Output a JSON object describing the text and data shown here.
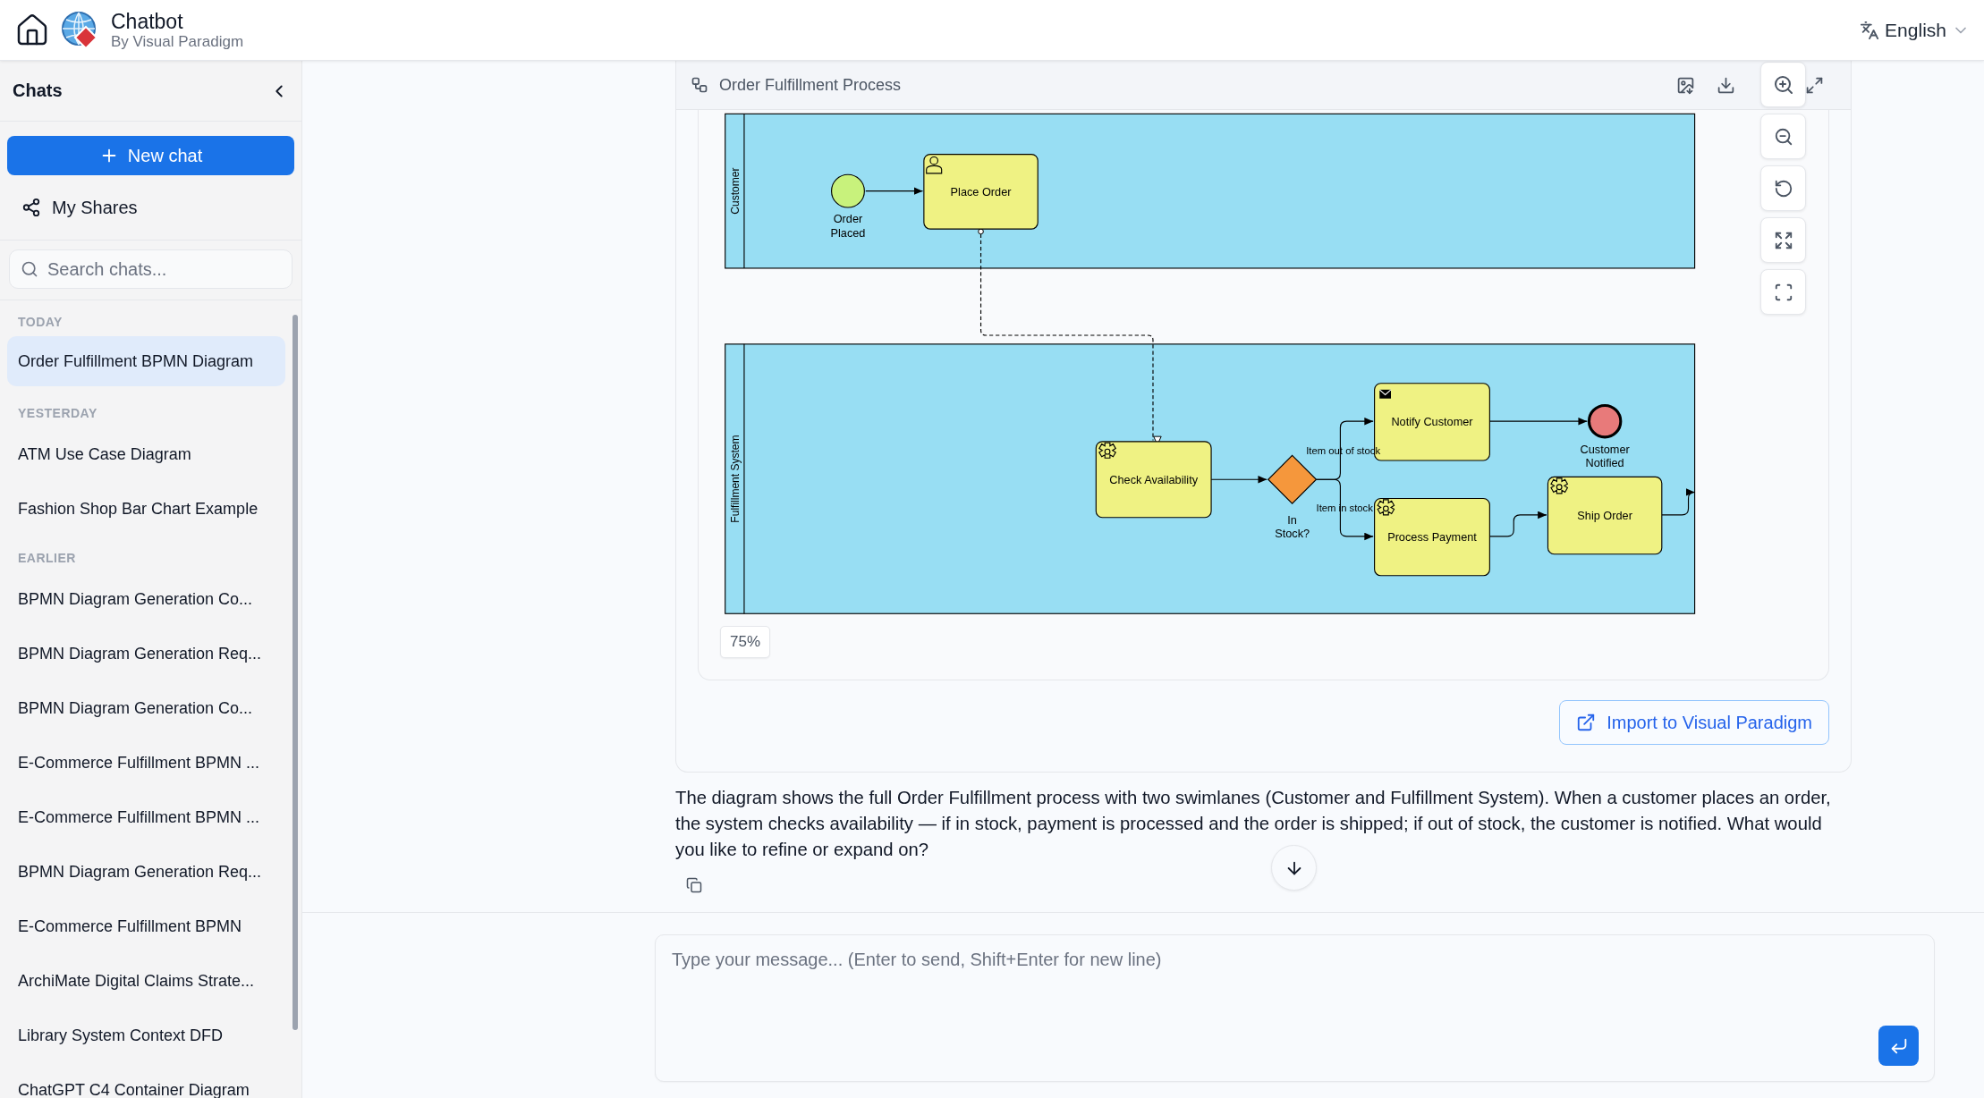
{
  "header": {
    "title": "Chatbot",
    "subtitle": "By Visual Paradigm",
    "language": "English"
  },
  "sidebar": {
    "title": "Chats",
    "new_chat": "New chat",
    "my_shares": "My Shares",
    "search_placeholder": "Search chats...",
    "groups": [
      {
        "label": "TODAY",
        "items": [
          {
            "title": "Order Fulfillment BPMN Diagram",
            "selected": true
          }
        ]
      },
      {
        "label": "YESTERDAY",
        "items": [
          {
            "title": "ATM Use Case Diagram",
            "selected": false
          },
          {
            "title": "Fashion Shop Bar Chart Example",
            "selected": false
          }
        ]
      },
      {
        "label": "EARLIER",
        "items": [
          {
            "title": "BPMN Diagram Generation Co...",
            "selected": false
          },
          {
            "title": "BPMN Diagram Generation Req...",
            "selected": false
          },
          {
            "title": "BPMN Diagram Generation Co...",
            "selected": false
          },
          {
            "title": "E-Commerce Fulfillment BPMN ...",
            "selected": false
          },
          {
            "title": "E-Commerce Fulfillment BPMN ...",
            "selected": false
          },
          {
            "title": "BPMN Diagram Generation Req...",
            "selected": false
          },
          {
            "title": "E-Commerce Fulfillment BPMN",
            "selected": false
          },
          {
            "title": "ArchiMate Digital Claims Strate...",
            "selected": false
          },
          {
            "title": "Library System Context DFD",
            "selected": false
          },
          {
            "title": "ChatGPT C4 Container Diagram",
            "selected": false
          }
        ]
      }
    ]
  },
  "diagram_card": {
    "title": "Order Fulfillment Process",
    "zoom": "75%",
    "import_button": "Import to Visual Paradigm",
    "diagram": {
      "lanes": [
        {
          "name": "Customer"
        },
        {
          "name": "Fulfillment System"
        }
      ],
      "nodes": [
        {
          "kind": "start_event",
          "label": "Order Placed"
        },
        {
          "kind": "user_task",
          "label": "Place Order"
        },
        {
          "kind": "service_task",
          "label": "Check Availability"
        },
        {
          "kind": "gateway",
          "label": "In Stock?"
        },
        {
          "kind": "send_task",
          "label": "Notify Customer"
        },
        {
          "kind": "end_event",
          "label": "Customer Notified"
        },
        {
          "kind": "service_task",
          "label": "Process Payment"
        },
        {
          "kind": "service_task",
          "label": "Ship Order"
        }
      ],
      "branch_labels": [
        "Item out of stock",
        "Item in stock"
      ]
    }
  },
  "message": "The diagram shows the full Order Fulfillment process with two swimlanes (Customer and Fulfillment System). When a customer places an order, the system checks availability — if in stock, payment is processed and the order is shipped; if out of stock, the customer is notified. What would you like to refine or expand on?",
  "composer": {
    "placeholder": "Type your message... (Enter to send, Shift+Enter for new line)"
  }
}
